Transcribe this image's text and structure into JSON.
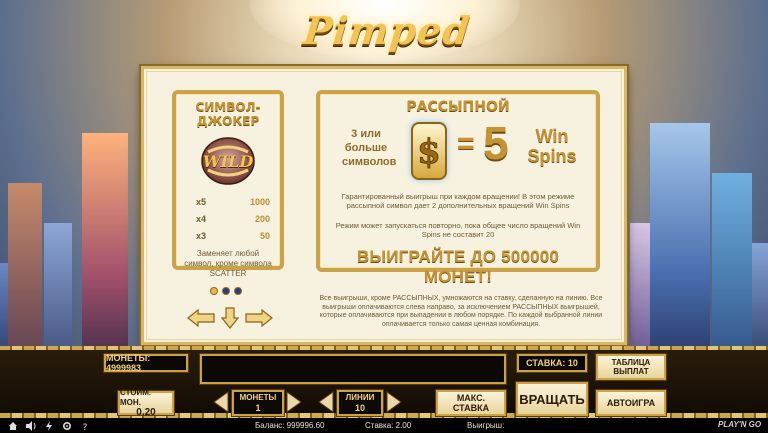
{
  "game": {
    "logo": "Pimped"
  },
  "paytable": {
    "wild": {
      "title": "СИМВОЛ-ДЖОКЕР",
      "symbol_label": "WILD",
      "pays": [
        {
          "count": "x5",
          "amount": "1000"
        },
        {
          "count": "x4",
          "amount": "200"
        },
        {
          "count": "x3",
          "amount": "50"
        }
      ],
      "note": "Заменяет любой символ, кроме символа SCATTER"
    },
    "scatter": {
      "title": "РАССЫПНОЙ",
      "condition": "3 или больше символов",
      "equals": "=",
      "spins_count": "5",
      "spins_label": "Win Spins",
      "desc1": "Гарантированный выигрыш при каждом вращении! В этом режиме рассыпной символ дает 2 дополнительных вращений Win Spins",
      "desc2": "Режим может запускаться повторно, пока общее число вращений Win Spins не составит 20",
      "win_text": "ВЫИГРАЙТЕ ДО 500000 МОНЕТ!"
    },
    "rules": "Все выигрыши, кроме РАССЫПНЫХ, умножаются на ставку, сделанную на линию. Все выигрыши оплачиваются слева направо, за исключением РАССЫПНЫХ выигрышей, которые оплачиваются при выпадении в любом порядке. По каждой выбранной линии оплачивается только самая ценная комбинация.",
    "pager": {
      "pages": 3,
      "active": 1
    }
  },
  "controls": {
    "coins_balance": "МОНЕТЫ: 4999983",
    "bet_display": "СТАВКА: 10",
    "paytable_button": "ТАБЛИЦА ВЫПЛАТ",
    "coin_value_label": "СТОИМ. МОН.",
    "coin_value": "0.20",
    "coins_label": "МОНЕТЫ",
    "coins_value": "1",
    "lines_label": "ЛИНИИ",
    "lines_value": "10",
    "max_bet_button": "МАКС. СТАВКА",
    "spin_button": "ВРАЩАТЬ",
    "autoplay_button": "АВТОИГРА"
  },
  "status": {
    "balance": "Баланс: 999996.60",
    "bet": "Ставка: 2.00",
    "win": "Выигрыш:",
    "brand": "PLAY'N GO"
  },
  "colors": {
    "gold": "#c39336",
    "panel": "#f6f0df",
    "dark": "#120c05"
  }
}
